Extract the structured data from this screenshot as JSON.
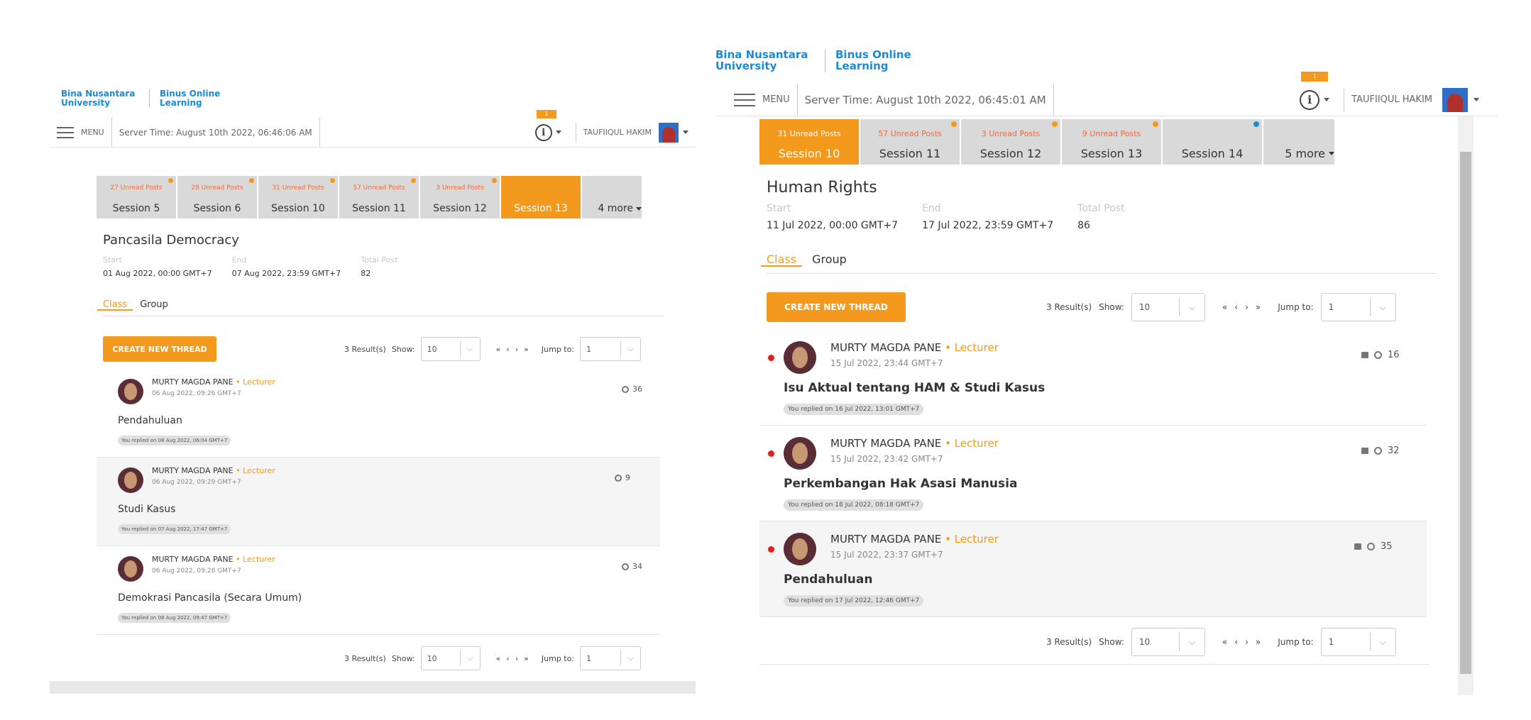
{
  "left": {
    "brand": {
      "university": "Bina Nusantara University",
      "product": "Binus Online Learning"
    },
    "topbar": {
      "menu_label": "MENU",
      "server_time": "Server Time: August 10th 2022, 06:46:06 AM",
      "info_count": "1",
      "user": "TAUFIIQUL HAKIM"
    },
    "tabs": [
      {
        "unread": "27 Unread Posts",
        "label": "Session 5",
        "active": false
      },
      {
        "unread": "28 Unread Posts",
        "label": "Session 6",
        "active": false
      },
      {
        "unread": "31 Unread Posts",
        "label": "Session 10",
        "active": false
      },
      {
        "unread": "57 Unread Posts",
        "label": "Session 11",
        "active": false
      },
      {
        "unread": "3 Unread Posts",
        "label": "Session 12",
        "active": false
      },
      {
        "unread": "",
        "label": "Session 13",
        "active": true
      }
    ],
    "more": "4 more",
    "topic": {
      "title": "Pancasila Democracy",
      "start_label": "Start",
      "start": "01 Aug 2022, 00:00 GMT+7",
      "end_label": "End",
      "end": "07 Aug 2022, 23:59 GMT+7",
      "total_label": "Total Post",
      "total": "82"
    },
    "subtabs": {
      "class": "Class",
      "group": "Group"
    },
    "create_button": "CREATE NEW THREAD",
    "pager": {
      "results": "3 Result(s)",
      "show": "Show:",
      "show_value": "10",
      "jump": "Jump to:",
      "jump_value": "1"
    },
    "posts": [
      {
        "author": "MURTY MAGDA PANE",
        "role": "Lecturer",
        "time": "06 Aug 2022, 09:26 GMT+7",
        "title": "Pendahuluan",
        "replied": "You replied on 08 Aug 2022, 06:04 GMT+7",
        "count": "36"
      },
      {
        "author": "MURTY MAGDA PANE",
        "role": "Lecturer",
        "time": "06 Aug 2022, 09:29 GMT+7",
        "title": "Studi Kasus",
        "replied": "You replied on 07 Aug 2022, 17:47 GMT+7",
        "count": "9"
      },
      {
        "author": "MURTY MAGDA PANE",
        "role": "Lecturer",
        "time": "06 Aug 2022, 09:28 GMT+7",
        "title": "Demokrasi Pancasila (Secara Umum)",
        "replied": "You replied on 08 Aug 2022, 09:47 GMT+7",
        "count": "34"
      }
    ]
  },
  "right": {
    "brand": {
      "university": "Bina Nusantara University",
      "product": "Binus Online Learning"
    },
    "topbar": {
      "menu_label": "MENU",
      "server_time": "Server Time: August 10th 2022, 06:45:01 AM",
      "info_count": "1",
      "user": "TAUFIIQUL HAKIM"
    },
    "tabs": [
      {
        "unread": "31 Unread Posts",
        "label": "Session 10",
        "active": true
      },
      {
        "unread": "57 Unread Posts",
        "label": "Session 11",
        "active": false
      },
      {
        "unread": "3 Unread Posts",
        "label": "Session 12",
        "active": false
      },
      {
        "unread": "9 Unread Posts",
        "label": "Session 13",
        "active": false
      },
      {
        "unread": "",
        "label": "Session 14",
        "active": false
      }
    ],
    "more": "5 more",
    "topic": {
      "title": "Human Rights",
      "start_label": "Start",
      "start": "11 Jul 2022, 00:00 GMT+7",
      "end_label": "End",
      "end": "17 Jul 2022, 23:59 GMT+7",
      "total_label": "Total Post",
      "total": "86"
    },
    "subtabs": {
      "class": "Class",
      "group": "Group"
    },
    "create_button": "CREATE NEW THREAD",
    "pager": {
      "results": "3 Result(s)",
      "show": "Show:",
      "show_value": "10",
      "jump": "Jump to:",
      "jump_value": "1"
    },
    "posts": [
      {
        "author": "MURTY MAGDA PANE",
        "role": "Lecturer",
        "time": "15 Jul 2022, 23:44 GMT+7",
        "title": "Isu Aktual tentang HAM & Studi Kasus",
        "replied": "You replied on 16 Jul 2022, 13:01 GMT+7",
        "count": "16"
      },
      {
        "author": "MURTY MAGDA PANE",
        "role": "Lecturer",
        "time": "15 Jul 2022, 23:42 GMT+7",
        "title": "Perkembangan Hak Asasi Manusia",
        "replied": "You replied on 18 Jul 2022, 08:18 GMT+7",
        "count": "32"
      },
      {
        "author": "MURTY MAGDA PANE",
        "role": "Lecturer",
        "time": "15 Jul 2022, 23:37 GMT+7",
        "title": "Pendahuluan",
        "replied": "You replied on 17 Jul 2022, 12:46 GMT+7",
        "count": "35"
      }
    ]
  },
  "colors": {
    "accent": "#f39a1e",
    "brand": "#1a8bd6",
    "unread": "#f06b3f",
    "new_post": "#e02020"
  }
}
